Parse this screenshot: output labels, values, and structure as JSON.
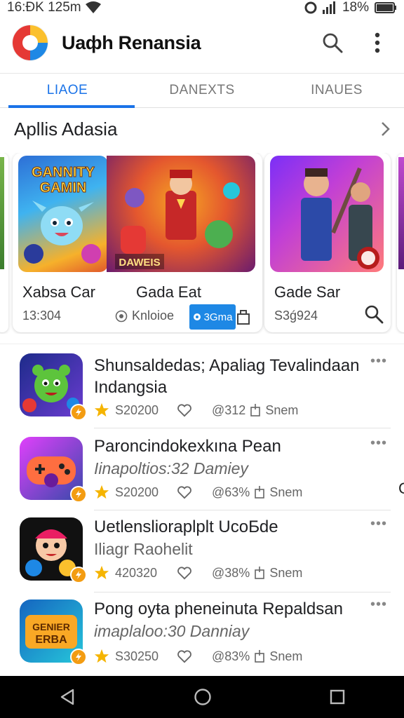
{
  "status_bar": {
    "time": "16:ÐK 125m",
    "battery": "18%"
  },
  "app": {
    "title": "Uaфh Renansia"
  },
  "tabs": [
    {
      "label": "LIAOE",
      "active": true
    },
    {
      "label": "DANEXTS",
      "active": false
    },
    {
      "label": "INAUES",
      "active": false
    }
  ],
  "section": {
    "title": "Apllis Adasia"
  },
  "cards": [
    {
      "title": "Xabsa Car",
      "meta": "13:304",
      "art_text_1": "GANNITY",
      "art_text_2": "GAMIN"
    },
    {
      "title": "Gada Eat",
      "meta": "Knloioe",
      "art_text": "DAWEIS",
      "pill_label": "3Gma"
    },
    {
      "title": "Gade Sar",
      "meta": "S3ǵ924"
    }
  ],
  "list": [
    {
      "name": "Shunsaldedas; Apaliag Tevalindaan Indangsia",
      "sub": "",
      "rating": "S20200",
      "pct": "@312",
      "size": "Snem",
      "thumb_text": ""
    },
    {
      "name": "Paroncindokexkına Pean",
      "sub": "Iinapoltios:32 Damiey",
      "rating": "S20200",
      "pct": "@63%",
      "size": "Snem",
      "thumb_text": ""
    },
    {
      "name": "Uetlenslioraplplt UcoƂde",
      "sub": "Iliagr Raohelit",
      "rating": "420320",
      "pct": "@38%",
      "size": "Snem",
      "thumb_text": ""
    },
    {
      "name": "Pong oyŧa pheneinuta Repaldsan",
      "sub": "imaplaloo:30 Danniay",
      "rating": "S30250",
      "pct": "@83%",
      "size": "Snem",
      "thumb_text": "GENIER ERBA"
    }
  ],
  "edge_text": "C",
  "colors": {
    "accent": "#1a73e8",
    "star": "#f5b400",
    "badge": "#f39c12"
  },
  "icons": [
    "search-icon",
    "more-vert-icon",
    "chevron-right-icon",
    "star-icon",
    "heart-icon",
    "download-icon",
    "back-icon",
    "home-icon",
    "recents-icon"
  ]
}
